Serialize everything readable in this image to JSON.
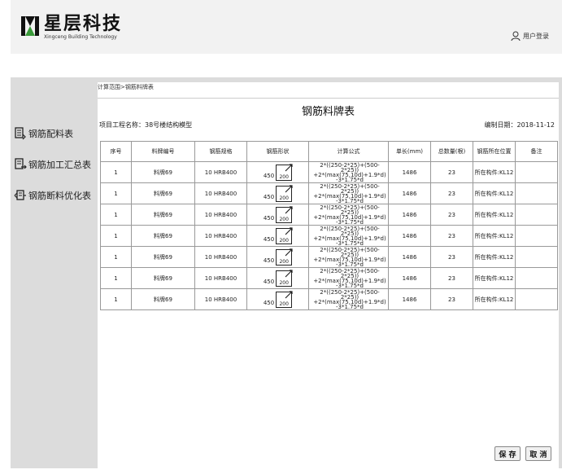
{
  "header": {
    "brand_cn": "星层科技",
    "brand_en": "Xingceng Building Technology",
    "user_login": "用户登录"
  },
  "sidebar": {
    "items": [
      {
        "label": "钢筋配料表"
      },
      {
        "label": "钢筋加工汇总表"
      },
      {
        "label": "钢筋断料优化表"
      }
    ]
  },
  "breadcrumb": "计算范围>钢筋料牌表",
  "document": {
    "title": "钢筋料牌表",
    "project_name": "项目工程名称：38号楼结构模型",
    "date": "编制日期：2018-11-12"
  },
  "table": {
    "headers": [
      "序号",
      "料牌编号",
      "钢筋规格",
      "钢筋形状",
      "计算公式",
      "单长(mm)",
      "总数量(根)",
      "钢筋所在位置",
      "备注"
    ],
    "rows": [
      {
        "no": "1",
        "tag": "料牌69",
        "spec": "10 HRB400",
        "shape_left": "450",
        "shape_box": "200",
        "formula": [
          "2*((250-2*25)+(500-2*25))",
          "+2*(max(75,10d)+1.9*d)",
          "-3*1.75*d"
        ],
        "length": "1486",
        "count": "23",
        "location": "所在构件:KL12",
        "note": ""
      },
      {
        "no": "1",
        "tag": "料牌69",
        "spec": "10 HRB400",
        "shape_left": "450",
        "shape_box": "200",
        "formula": [
          "2*((250-2*25)+(500-2*25))",
          "+2*(max(75,10d)+1.9*d)",
          "-3*1.75*d"
        ],
        "length": "1486",
        "count": "23",
        "location": "所在构件:KL12",
        "note": ""
      },
      {
        "no": "1",
        "tag": "料牌69",
        "spec": "10 HRB400",
        "shape_left": "450",
        "shape_box": "200",
        "formula": [
          "2*((250-2*25)+(500-2*25))",
          "+2*(max(75,10d)+1.9*d)",
          "-3*1.75*d"
        ],
        "length": "1486",
        "count": "23",
        "location": "所在构件:KL12",
        "note": ""
      },
      {
        "no": "1",
        "tag": "料牌69",
        "spec": "10 HRB400",
        "shape_left": "450",
        "shape_box": "200",
        "formula": [
          "2*((250-2*25)+(500-2*25))",
          "+2*(max(75,10d)+1.9*d)",
          "-3*1.75*d"
        ],
        "length": "1486",
        "count": "23",
        "location": "所在构件:KL12",
        "note": ""
      },
      {
        "no": "1",
        "tag": "料牌69",
        "spec": "10 HRB400",
        "shape_left": "450",
        "shape_box": "200",
        "formula": [
          "2*((250-2*25)+(500-2*25))",
          "+2*(max(75,10d)+1.9*d)",
          "-3*1.75*d"
        ],
        "length": "1486",
        "count": "23",
        "location": "所在构件:KL12",
        "note": ""
      },
      {
        "no": "1",
        "tag": "料牌69",
        "spec": "10 HRB400",
        "shape_left": "450",
        "shape_box": "200",
        "formula": [
          "2*((250-2*25)+(500-2*25))",
          "+2*(max(75,10d)+1.9*d)",
          "-3*1.75*d"
        ],
        "length": "1486",
        "count": "23",
        "location": "所在构件:KL12",
        "note": ""
      },
      {
        "no": "1",
        "tag": "料牌69",
        "spec": "10 HRB400",
        "shape_left": "450",
        "shape_box": "200",
        "formula": [
          "2*((250-2*25)+(500-2*25))",
          "+2*(max(75,10d)+1.9*d)",
          "-3*1.75*d"
        ],
        "length": "1486",
        "count": "23",
        "location": "所在构件:KL12",
        "note": ""
      }
    ]
  },
  "buttons": {
    "save": "保 存",
    "cancel": "取 消"
  },
  "icons": {
    "logo": "xingceng-logo-icon",
    "user": "user-icon",
    "sidebar": [
      "document-list-icon",
      "document-arrow-icon",
      "document-cut-icon"
    ],
    "shape": "hook-bend-icon"
  }
}
